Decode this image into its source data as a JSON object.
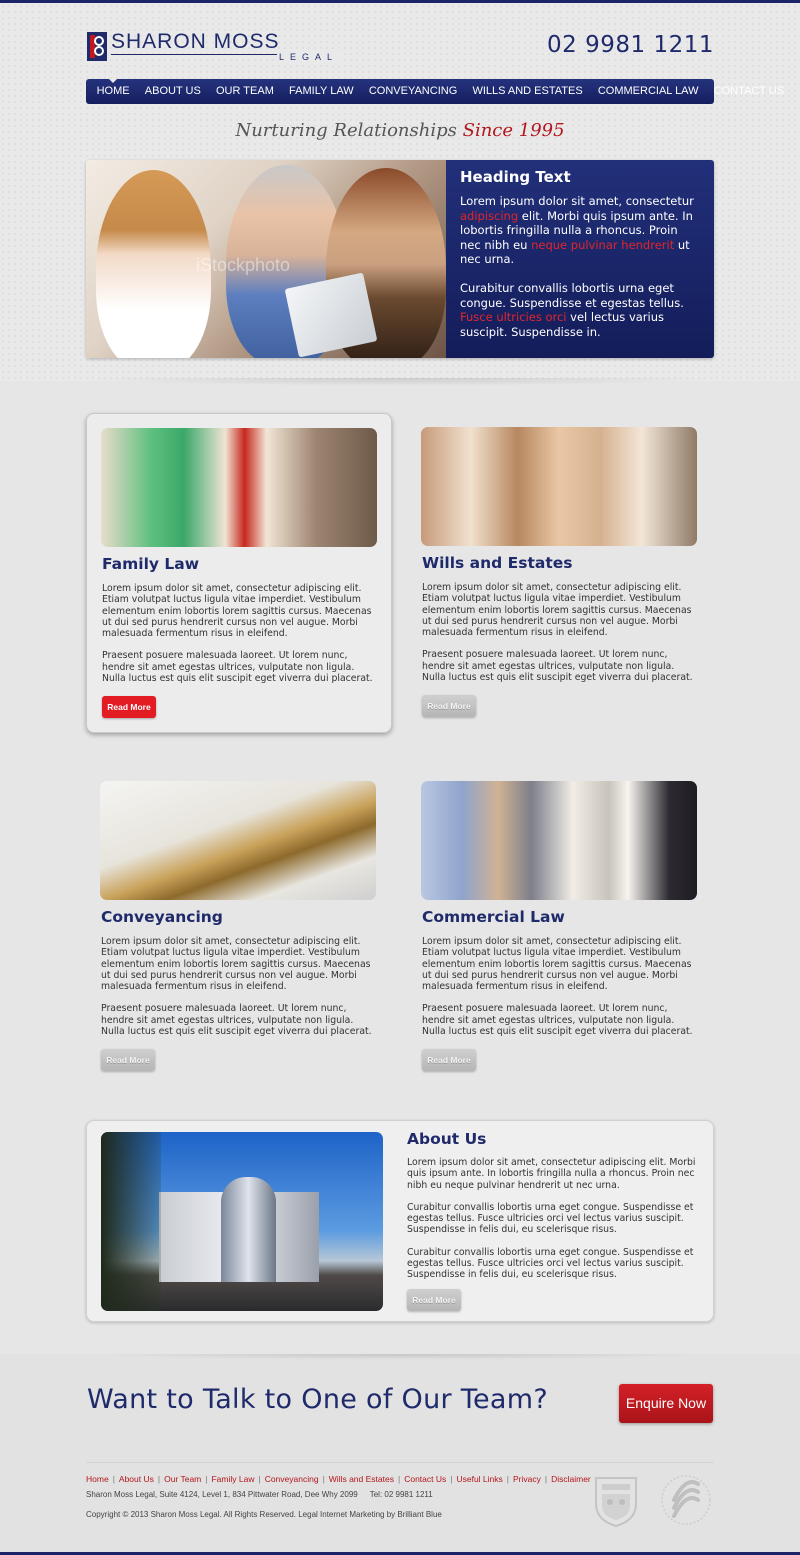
{
  "brand": {
    "name": "SHARON MOSS",
    "subtitle": "LEGAL",
    "phone": "02 9981 1211"
  },
  "nav": {
    "items": [
      {
        "label": "HOME",
        "active": true
      },
      {
        "label": "ABOUT US"
      },
      {
        "label": "OUR TEAM"
      },
      {
        "label": "FAMILY LAW"
      },
      {
        "label": "CONVEYANCING"
      },
      {
        "label": "WILLS AND ESTATES"
      },
      {
        "label": "COMMERCIAL LAW"
      },
      {
        "label": "CONTACT US"
      }
    ]
  },
  "tagline": {
    "text": "Nurturing Relationships",
    "highlight": "Since 1995"
  },
  "hero": {
    "heading": "Heading Text",
    "p1_a": "Lorem ipsum dolor sit amet, consectetur ",
    "p1_red1": "adipiscing",
    "p1_b": " elit. Morbi quis ipsum ante. In lobortis fringilla nulla a rhoncus. Proin nec nibh eu ",
    "p1_red2": "neque pulvinar hendrerit",
    "p1_c": " ut nec urna.",
    "p2_a": "Curabitur convallis lobortis urna eget congue. Suspendisse et egestas tellus. ",
    "p2_red": "Fusce ultricies orci",
    "p2_b": " vel lectus varius suscipit. Suspendisse in.",
    "watermark": "iStockphoto"
  },
  "services": [
    {
      "title": "Family Law",
      "p1": "Lorem ipsum dolor sit amet, consectetur adipiscing elit. Etiam volutpat luctus ligula vitae imperdiet. Vestibulum elementum enim lobortis lorem sagittis cursus. Maecenas ut dui sed purus hendrerit cursus non vel augue. Morbi malesuada fermentum risus in eleifend.",
      "p2": "Praesent posuere malesuada laoreet. Ut lorem nunc, hendre sit amet egestas ultrices, vulputate non ligula. Nulla luctus est quis elit suscipit eget viverra dui placerat.",
      "button": "Read More"
    },
    {
      "title": "Wills and Estates",
      "p1": "Lorem ipsum dolor sit amet, consectetur adipiscing elit. Etiam volutpat luctus ligula vitae imperdiet. Vestibulum elementum enim lobortis lorem sagittis cursus. Maecenas ut dui sed purus hendrerit cursus non vel augue. Morbi malesuada fermentum risus in eleifend.",
      "p2": "Praesent posuere malesuada laoreet. Ut lorem nunc, hendre sit amet egestas ultrices, vulputate non ligula. Nulla luctus est quis elit suscipit eget viverra dui placerat.",
      "button": "Read More"
    },
    {
      "title": "Conveyancing",
      "p1": "Lorem ipsum dolor sit amet, consectetur adipiscing elit. Etiam volutpat luctus ligula vitae imperdiet. Vestibulum elementum enim lobortis lorem sagittis cursus. Maecenas ut dui sed purus hendrerit cursus non vel augue. Morbi malesuada fermentum risus in eleifend.",
      "p2": "Praesent posuere malesuada laoreet. Ut lorem nunc, hendre sit amet egestas ultrices, vulputate non ligula. Nulla luctus est quis elit suscipit eget viverra dui placerat.",
      "button": "Read More"
    },
    {
      "title": "Commercial Law",
      "p1": "Lorem ipsum dolor sit amet, consectetur adipiscing elit. Etiam volutpat luctus ligula vitae imperdiet. Vestibulum elementum enim lobortis lorem sagittis cursus. Maecenas ut dui sed purus hendrerit cursus non vel augue. Morbi malesuada fermentum risus in eleifend.",
      "p2": "Praesent posuere malesuada laoreet. Ut lorem nunc, hendre sit amet egestas ultrices, vulputate non ligula. Nulla luctus est quis elit suscipit eget viverra dui placerat.",
      "button": "Read More"
    }
  ],
  "about": {
    "title": "About Us",
    "p1": "Lorem ipsum dolor sit amet, consectetur adipiscing elit. Morbi quis ipsum ante. In lobortis fringilla nulla a rhoncus. Proin nec nibh eu neque pulvinar hendrerit ut nec urna.",
    "p2": "Curabitur convallis lobortis urna eget congue. Suspendisse et egestas tellus. Fusce ultricies orci vel lectus varius suscipit. Suspendisse in felis dui, eu scelerisque risus.",
    "p3": "Curabitur convallis lobortis urna eget congue. Suspendisse et egestas tellus. Fusce ultricies orci vel lectus varius suscipit. Suspendisse in felis dui, eu scelerisque risus.",
    "button": "Read More"
  },
  "cta": {
    "text": "Want to Talk to One of Our Team?",
    "button": "Enquire Now"
  },
  "footer": {
    "links": [
      "Home",
      "About Us",
      "Our Team",
      "Family Law",
      "Conveyancing",
      "Wills and Estates",
      "Contact Us",
      "Useful Links",
      "Privacy",
      "Disclaimer"
    ],
    "address": "Sharon Moss Legal, Suite 4124, Level 1, 834 Pittwater Road, Dee Why 2099",
    "tel": "Tel: 02 9981 1211",
    "copyright": "Copyright © 2013 Sharon Moss Legal. All Rights Reserved. Legal Internet Marketing by Brilliant Blue"
  },
  "colors": {
    "navy": "#1f2a6b",
    "red": "#c4161c",
    "background": "#e6e6e6"
  }
}
